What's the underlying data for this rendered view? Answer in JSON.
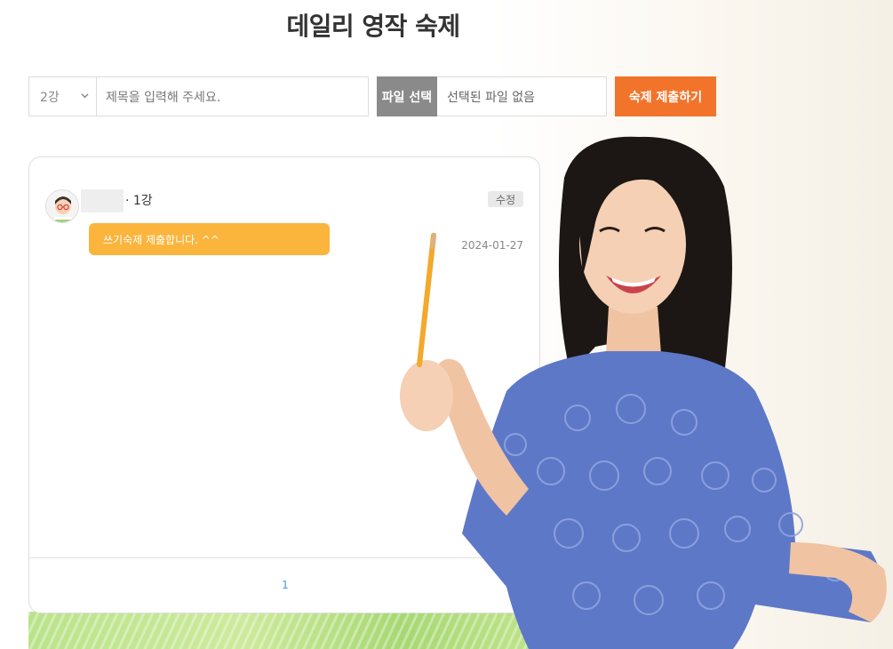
{
  "page": {
    "title": "데일리 영작 숙제"
  },
  "form": {
    "lesson_select_value": "2강",
    "title_placeholder": "제목을 입력해 주세요.",
    "file_button_label": "파일 선택",
    "file_status": "선택된 파일 없음",
    "submit_label": "숙제 제출하기"
  },
  "board": {
    "posts": [
      {
        "lesson": "· 1강",
        "edit_label": "수정",
        "message": "쓰기숙제 제출합니다. ^^",
        "date": "2024-01-27"
      }
    ],
    "pagination": {
      "current_page": "1"
    }
  },
  "colors": {
    "submit_button": "#f2742a",
    "file_button": "#8a8a8a",
    "message_bubble": "#fbb43c",
    "page_number": "#4d97d6",
    "dress": "#5e78c8"
  },
  "icons": {
    "select_arrow": "chevron-down-icon",
    "avatar": "avatar-icon"
  }
}
